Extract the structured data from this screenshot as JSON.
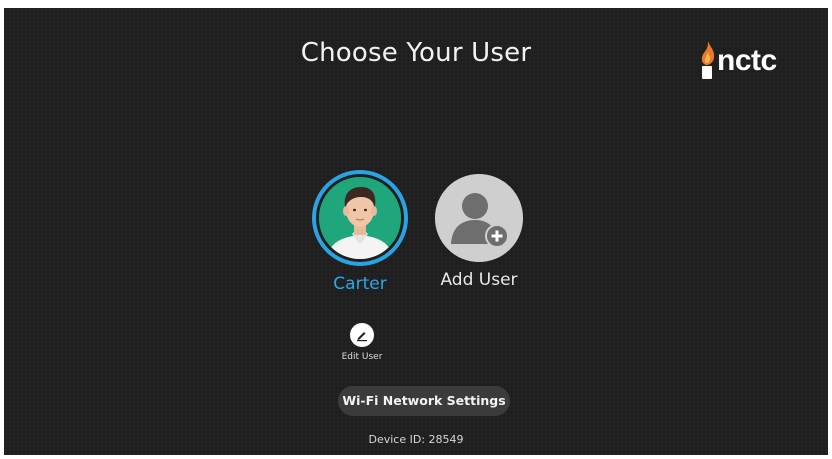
{
  "screen": {
    "title": "Choose Your User"
  },
  "logo": {
    "text": "nctc",
    "icon": "flame-i-icon",
    "accent": "#e8792d"
  },
  "users": [
    {
      "name": "Carter",
      "icon": "user-avatar-photo",
      "selected": true,
      "avatar_color": "#1fa67b"
    },
    {
      "name": "Add User",
      "icon": "add-user-icon",
      "selected": false
    }
  ],
  "edit_user": {
    "label": "Edit User",
    "icon": "pencil-icon"
  },
  "wifi": {
    "label": "Wi-Fi Network Settings"
  },
  "device": {
    "label": "Device ID: 28549"
  },
  "colors": {
    "background": "#1f1f1f",
    "selection_accent": "#2aa8ea",
    "button_background": "#3b3b3b"
  }
}
